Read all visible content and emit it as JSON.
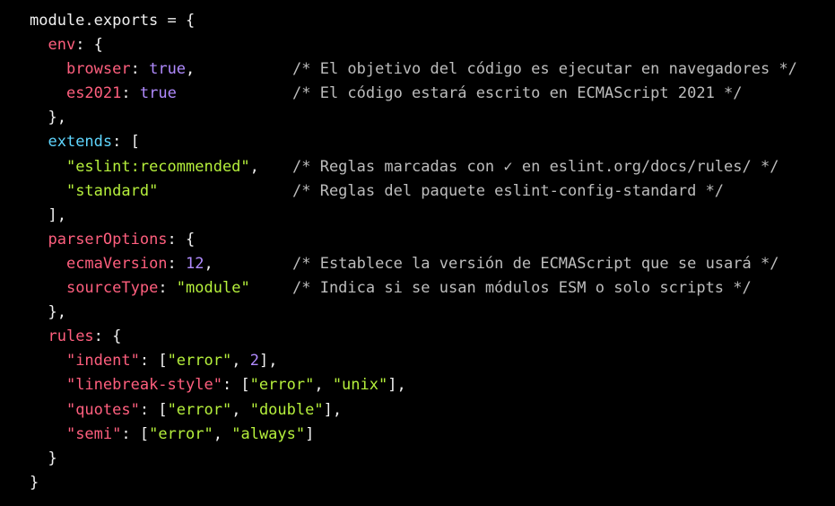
{
  "colors": {
    "background": "#000000",
    "plain": "#f0f0f0",
    "key": "#ff5f7e",
    "key_top": "#5fd6ff",
    "boolean_number": "#b18bff",
    "string": "#b6f03c",
    "comment": "#bdbdbd"
  },
  "code": {
    "language": "javascript",
    "lines": [
      {
        "tokens": [
          {
            "t": "module.exports = {",
            "k": "plain"
          }
        ]
      },
      {
        "tokens": [
          {
            "t": "  ",
            "k": "plain"
          },
          {
            "t": "env",
            "k": "key"
          },
          {
            "t": ": {",
            "k": "plain"
          }
        ]
      },
      {
        "tokens": [
          {
            "t": "    ",
            "k": "plain"
          },
          {
            "t": "browser",
            "k": "key"
          },
          {
            "t": ": ",
            "k": "plain"
          },
          {
            "t": "true",
            "k": "bool"
          },
          {
            "t": ",",
            "k": "plain"
          }
        ],
        "comment": "/* El objetivo del código es ejecutar en navegadores */"
      },
      {
        "tokens": [
          {
            "t": "    ",
            "k": "plain"
          },
          {
            "t": "es2021",
            "k": "key"
          },
          {
            "t": ": ",
            "k": "plain"
          },
          {
            "t": "true",
            "k": "bool"
          }
        ],
        "comment": "/* El código estará escrito en ECMAScript 2021 */"
      },
      {
        "tokens": [
          {
            "t": "  },",
            "k": "plain"
          }
        ]
      },
      {
        "tokens": [
          {
            "t": "  ",
            "k": "plain"
          },
          {
            "t": "extends",
            "k": "key2"
          },
          {
            "t": ": [",
            "k": "plain"
          }
        ]
      },
      {
        "tokens": [
          {
            "t": "    ",
            "k": "plain"
          },
          {
            "t": "\"eslint:recommended\"",
            "k": "str"
          },
          {
            "t": ",",
            "k": "plain"
          }
        ],
        "comment": "/* Reglas marcadas con ✓ en eslint.org/docs/rules/ */"
      },
      {
        "tokens": [
          {
            "t": "    ",
            "k": "plain"
          },
          {
            "t": "\"standard\"",
            "k": "str"
          }
        ],
        "comment": "/* Reglas del paquete eslint-config-standard */"
      },
      {
        "tokens": [
          {
            "t": "  ],",
            "k": "plain"
          }
        ]
      },
      {
        "tokens": [
          {
            "t": "  ",
            "k": "plain"
          },
          {
            "t": "parserOptions",
            "k": "key"
          },
          {
            "t": ": {",
            "k": "plain"
          }
        ]
      },
      {
        "tokens": [
          {
            "t": "    ",
            "k": "plain"
          },
          {
            "t": "ecmaVersion",
            "k": "key"
          },
          {
            "t": ": ",
            "k": "plain"
          },
          {
            "t": "12",
            "k": "num"
          },
          {
            "t": ",",
            "k": "plain"
          }
        ],
        "comment": "/* Establece la versión de ECMAScript que se usará */"
      },
      {
        "tokens": [
          {
            "t": "    ",
            "k": "plain"
          },
          {
            "t": "sourceType",
            "k": "key"
          },
          {
            "t": ": ",
            "k": "plain"
          },
          {
            "t": "\"module\"",
            "k": "str"
          }
        ],
        "comment": "/* Indica si se usan módulos ESM o solo scripts */"
      },
      {
        "tokens": [
          {
            "t": "  },",
            "k": "plain"
          }
        ]
      },
      {
        "tokens": [
          {
            "t": "  ",
            "k": "plain"
          },
          {
            "t": "rules",
            "k": "key"
          },
          {
            "t": ": {",
            "k": "plain"
          }
        ]
      },
      {
        "tokens": [
          {
            "t": "    ",
            "k": "plain"
          },
          {
            "t": "\"indent\"",
            "k": "key"
          },
          {
            "t": ": [",
            "k": "plain"
          },
          {
            "t": "\"error\"",
            "k": "str"
          },
          {
            "t": ", ",
            "k": "plain"
          },
          {
            "t": "2",
            "k": "num"
          },
          {
            "t": "],",
            "k": "plain"
          }
        ]
      },
      {
        "tokens": [
          {
            "t": "    ",
            "k": "plain"
          },
          {
            "t": "\"linebreak-style\"",
            "k": "key"
          },
          {
            "t": ": [",
            "k": "plain"
          },
          {
            "t": "\"error\"",
            "k": "str"
          },
          {
            "t": ", ",
            "k": "plain"
          },
          {
            "t": "\"unix\"",
            "k": "str"
          },
          {
            "t": "],",
            "k": "plain"
          }
        ]
      },
      {
        "tokens": [
          {
            "t": "    ",
            "k": "plain"
          },
          {
            "t": "\"quotes\"",
            "k": "key"
          },
          {
            "t": ": [",
            "k": "plain"
          },
          {
            "t": "\"error\"",
            "k": "str"
          },
          {
            "t": ", ",
            "k": "plain"
          },
          {
            "t": "\"double\"",
            "k": "str"
          },
          {
            "t": "],",
            "k": "plain"
          }
        ]
      },
      {
        "tokens": [
          {
            "t": "    ",
            "k": "plain"
          },
          {
            "t": "\"semi\"",
            "k": "key"
          },
          {
            "t": ": [",
            "k": "plain"
          },
          {
            "t": "\"error\"",
            "k": "str"
          },
          {
            "t": ", ",
            "k": "plain"
          },
          {
            "t": "\"always\"",
            "k": "str"
          },
          {
            "t": "]",
            "k": "plain"
          }
        ]
      },
      {
        "tokens": [
          {
            "t": "  }",
            "k": "plain"
          }
        ]
      },
      {
        "tokens": [
          {
            "t": "}",
            "k": "plain"
          }
        ]
      }
    ]
  }
}
